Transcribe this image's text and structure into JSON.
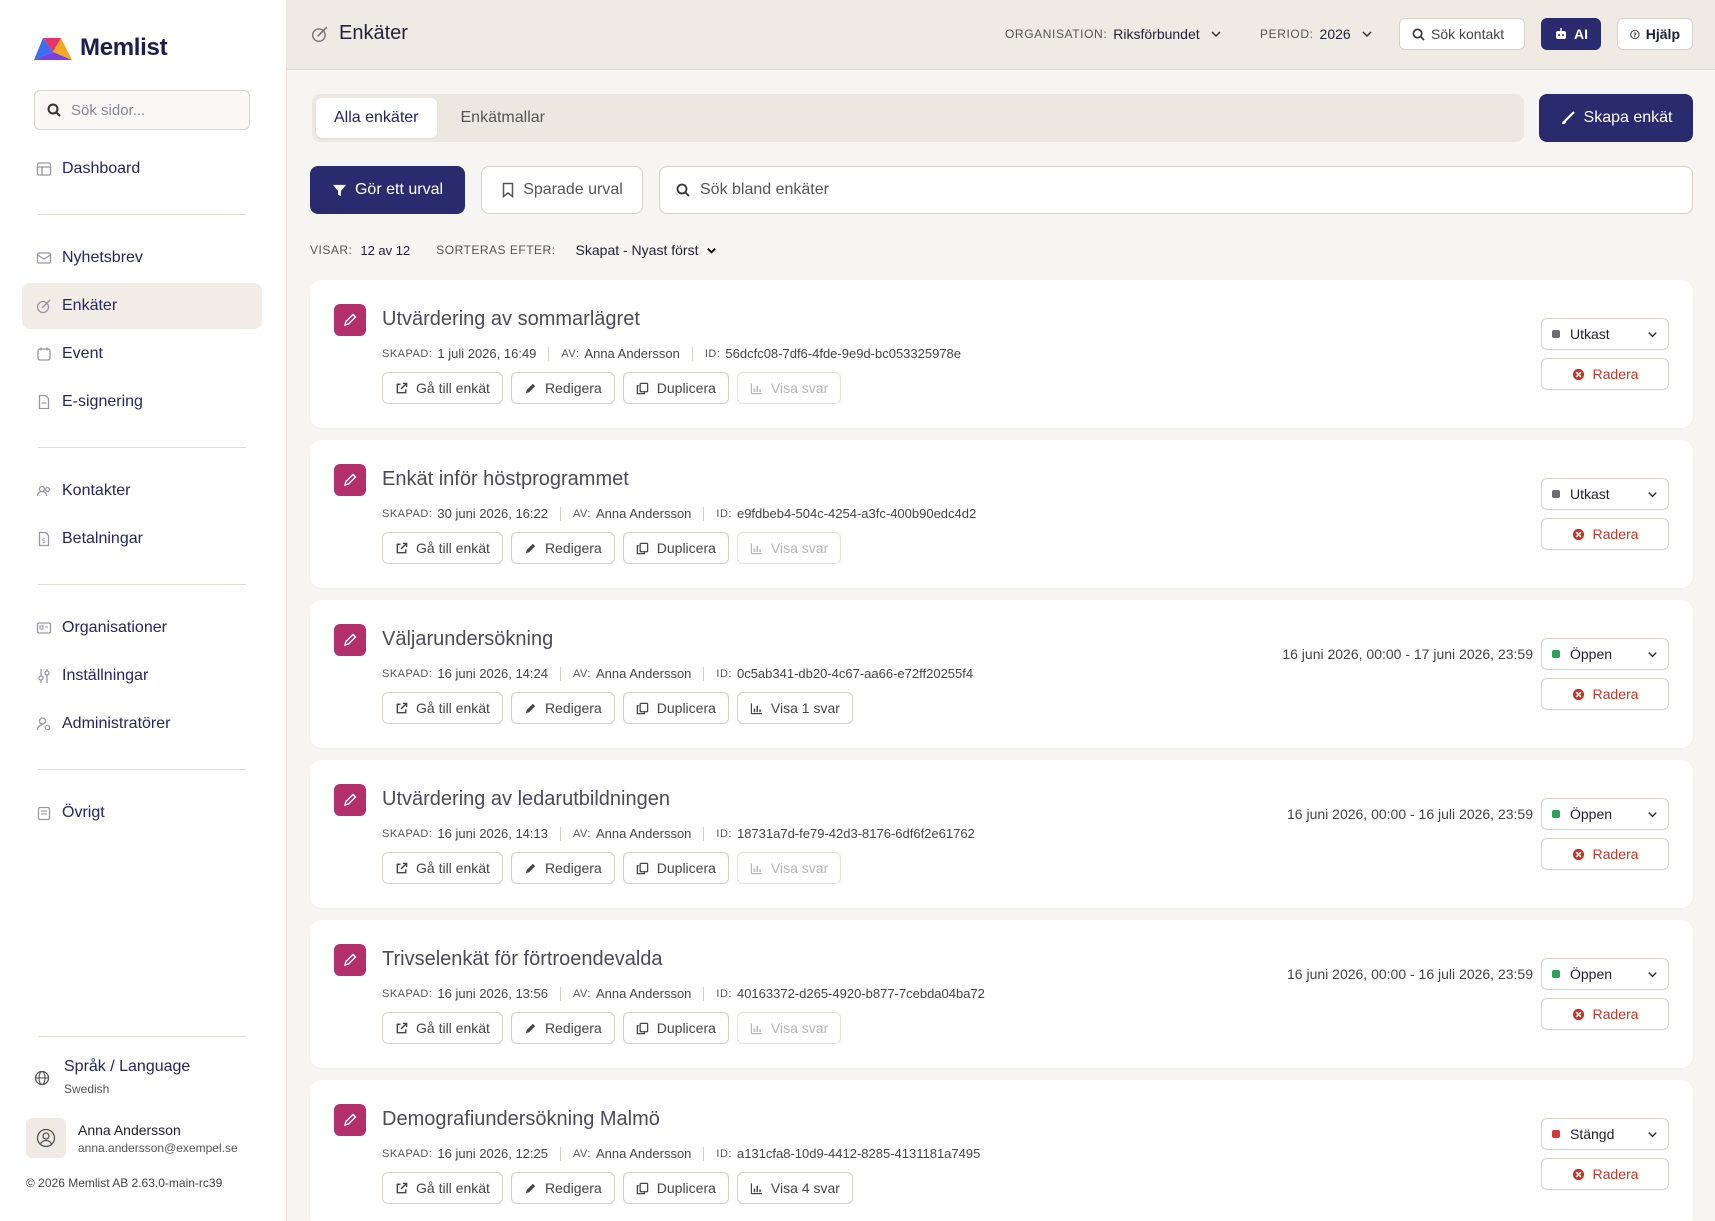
{
  "app": {
    "name": "Memlist"
  },
  "sidebar": {
    "search_placeholder": "Sök sidor...",
    "items": [
      {
        "label": "Dashboard",
        "icon": "dashboard-icon"
      },
      {
        "label": "Nyhetsbrev",
        "icon": "newsletter-icon"
      },
      {
        "label": "Enkäter",
        "icon": "survey-icon",
        "active": true
      },
      {
        "label": "Event",
        "icon": "event-icon"
      },
      {
        "label": "E-signering",
        "icon": "document-icon"
      },
      {
        "label": "Kontakter",
        "icon": "contacts-icon"
      },
      {
        "label": "Betalningar",
        "icon": "payments-icon"
      },
      {
        "label": "Organisationer",
        "icon": "organisations-icon"
      },
      {
        "label": "Inställningar",
        "icon": "settings-icon"
      },
      {
        "label": "Administratörer",
        "icon": "admins-icon"
      },
      {
        "label": "Övrigt",
        "icon": "other-icon"
      }
    ],
    "language": {
      "title": "Språk / Language",
      "value": "Swedish"
    },
    "user": {
      "name": "Anna Andersson",
      "email": "anna.andersson@exempel.se"
    },
    "copyright": "© 2026  Memlist AB 2.63.0-main-rc39"
  },
  "header": {
    "title": "Enkäter",
    "org_label": "ORGANISATION:",
    "org_value": "Riksförbundet",
    "period_label": "PERIOD:",
    "period_value": "2026",
    "search_contact": "Sök kontakt",
    "ai": "AI",
    "help": "Hjälp"
  },
  "tabs": {
    "all": "Alla enkäter",
    "templates": "Enkätmallar"
  },
  "create_button": "Skapa enkät",
  "filter": {
    "select": "Gör ett urval",
    "saved": "Sparade urval",
    "search_placeholder": "Sök bland enkäter"
  },
  "meta": {
    "showing_label": "VISAR:",
    "showing_value": "12 av 12",
    "sort_label": "SORTERAS EFTER:",
    "sort_value": "Skapat - Nyast först"
  },
  "labels": {
    "created": "SKAPAD:",
    "by": "AV:",
    "id": "ID:",
    "goto": "Gå till enkät",
    "edit": "Redigera",
    "duplicate": "Duplicera",
    "delete": "Radera"
  },
  "colors": {
    "primary": "#2a2a6e",
    "survey_icon": "#b3306b",
    "draft": "#6b6b78",
    "open": "#2e9e5b",
    "closed": "#d23b3b",
    "danger": "#c0392b"
  },
  "surveys": [
    {
      "title": "Utvärdering av sommarlägret",
      "created": "1 juli 2026, 16:49",
      "author": "Anna Andersson",
      "id": "56dcfc08-7df6-4fde-9e9d-bc053325978e",
      "responses": "Visa svar",
      "responses_disabled": true,
      "date_range": "",
      "status": "Utkast",
      "status_color": "#6b6b78"
    },
    {
      "title": "Enkät inför höstprogrammet",
      "created": "30 juni 2026, 16:22",
      "author": "Anna Andersson",
      "id": "e9fdbeb4-504c-4254-a3fc-400b90edc4d2",
      "responses": "Visa svar",
      "responses_disabled": true,
      "date_range": "",
      "status": "Utkast",
      "status_color": "#6b6b78"
    },
    {
      "title": "Väljarundersökning",
      "created": "16 juni 2026, 14:24",
      "author": "Anna Andersson",
      "id": "0c5ab341-db20-4c67-aa66-e72ff20255f4",
      "responses": "Visa 1 svar",
      "responses_disabled": false,
      "date_range": "16 juni 2026, 00:00 - 17 juni 2026, 23:59",
      "status": "Öppen",
      "status_color": "#2e9e5b"
    },
    {
      "title": "Utvärdering av ledarutbildningen",
      "created": "16 juni 2026, 14:13",
      "author": "Anna Andersson",
      "id": "18731a7d-fe79-42d3-8176-6df6f2e61762",
      "responses": "Visa svar",
      "responses_disabled": true,
      "date_range": "16 juni 2026, 00:00 - 16 juli 2026, 23:59",
      "status": "Öppen",
      "status_color": "#2e9e5b"
    },
    {
      "title": "Trivselenkät för förtroendevalda",
      "created": "16 juni 2026, 13:56",
      "author": "Anna Andersson",
      "id": "40163372-d265-4920-b877-7cebda04ba72",
      "responses": "Visa svar",
      "responses_disabled": true,
      "date_range": "16 juni 2026, 00:00 - 16 juli 2026, 23:59",
      "status": "Öppen",
      "status_color": "#2e9e5b"
    },
    {
      "title": "Demografiundersökning Malmö",
      "created": "16 juni 2026, 12:25",
      "author": "Anna Andersson",
      "id": "a131cfa8-10d9-4412-8285-4131181a7495",
      "responses": "Visa 4 svar",
      "responses_disabled": false,
      "date_range": "",
      "status": "Stängd",
      "status_color": "#d23b3b"
    }
  ]
}
